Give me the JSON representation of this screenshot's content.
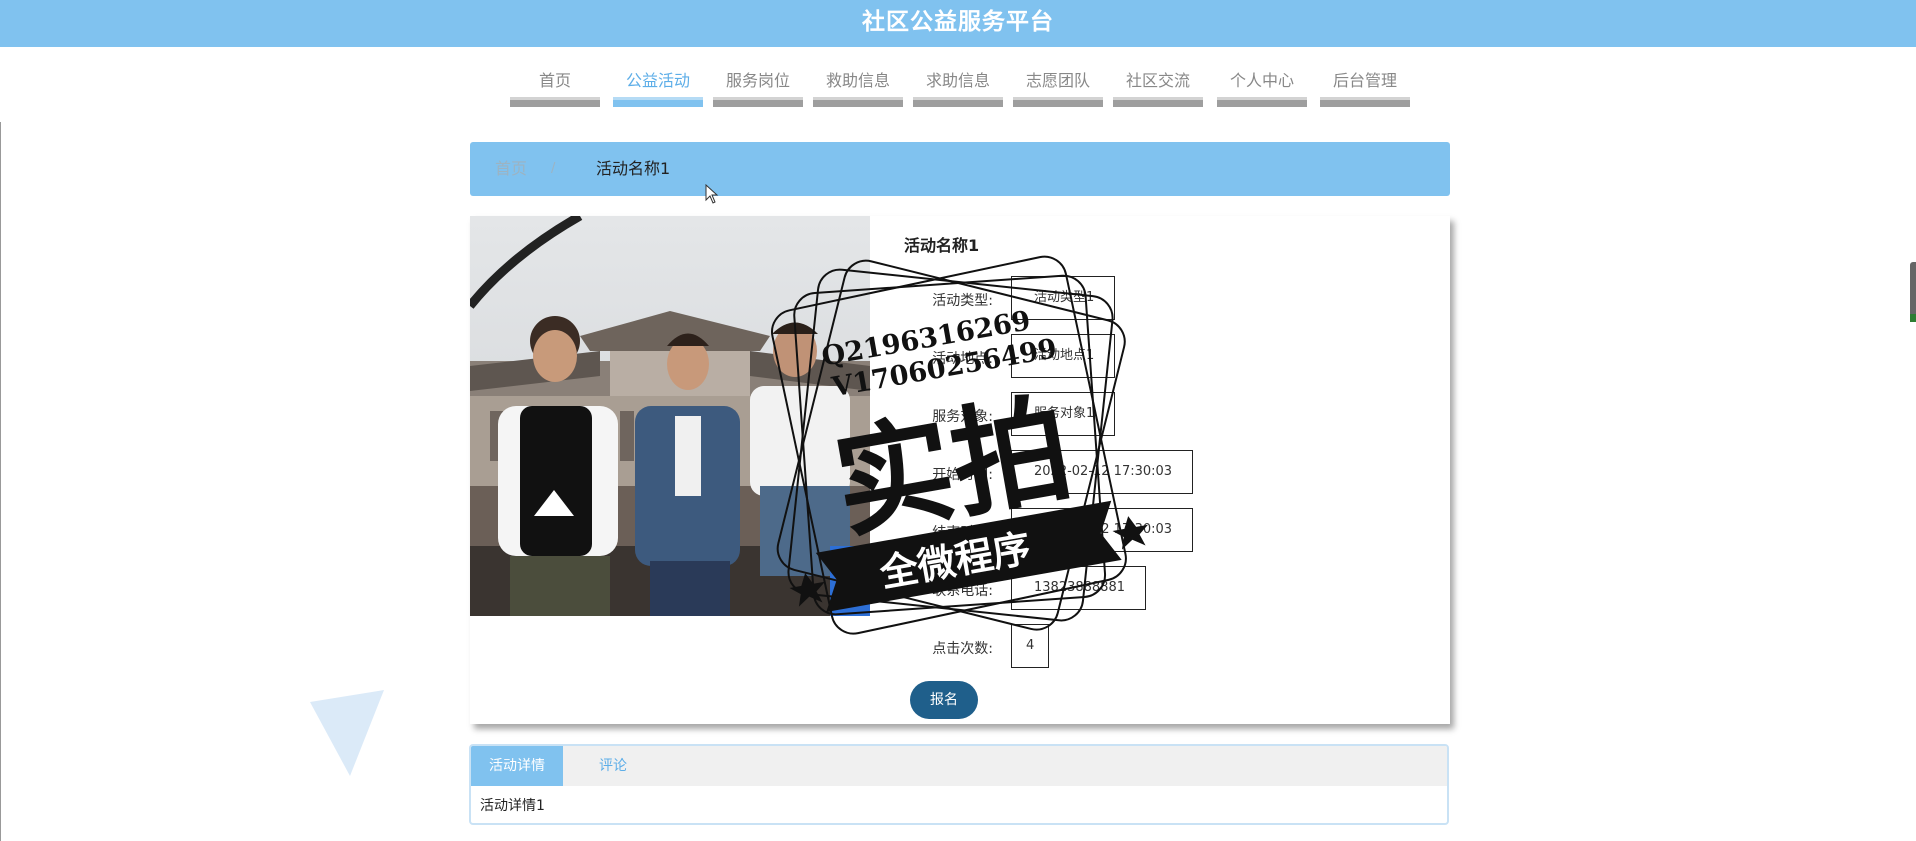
{
  "header": {
    "title": "社区公益服务平台"
  },
  "nav": {
    "items": [
      {
        "label": "首页"
      },
      {
        "label": "公益活动"
      },
      {
        "label": "服务岗位"
      },
      {
        "label": "救助信息"
      },
      {
        "label": "求助信息"
      },
      {
        "label": "志愿团队"
      },
      {
        "label": "社区交流"
      },
      {
        "label": "个人中心"
      },
      {
        "label": "后台管理"
      }
    ],
    "active": "公益活动"
  },
  "breadcrumb": {
    "home": "首页",
    "separator": "/",
    "current": "活动名称1"
  },
  "activity": {
    "name": "活动名称1",
    "fields": [
      {
        "label": "活动类型:",
        "value": "活动类型1"
      },
      {
        "label": "活动地点:",
        "value": "活动地点1"
      },
      {
        "label": "服务对象:",
        "value": "服务对象1"
      },
      {
        "label": "开始时间:",
        "value": "2022-02-12 17:30:03"
      },
      {
        "label": "结束时间:",
        "value": "2022-02-12 17:30:03"
      },
      {
        "label": "联系电话:",
        "value": "13823888881"
      },
      {
        "label": "点击次数:",
        "value": "4"
      }
    ],
    "signup_label": "报名"
  },
  "watermark": {
    "line1": "Q2196316269",
    "line2": "V17060256499",
    "main": "实拍",
    "ribbon": "全微程序"
  },
  "tabs": {
    "items": [
      {
        "label": "活动详情"
      },
      {
        "label": "评论"
      }
    ],
    "active": "活动详情",
    "content": "活动详情1"
  },
  "colors": {
    "header_bg": "#80c2ef",
    "accent": "#5daee8",
    "button": "#1f5f8b"
  }
}
